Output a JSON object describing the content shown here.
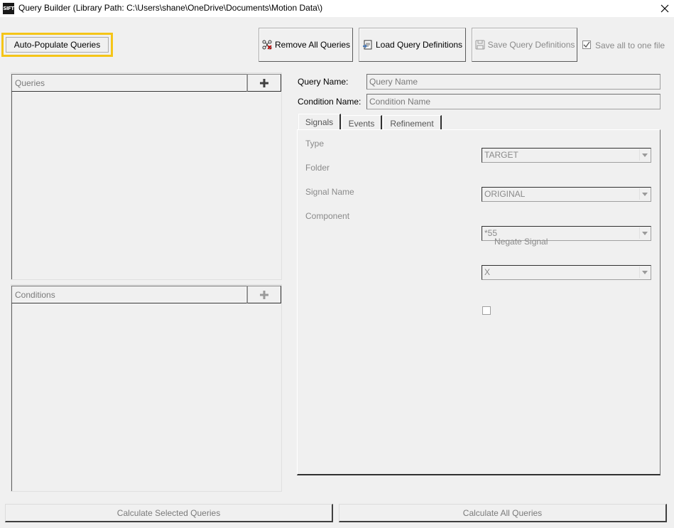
{
  "window": {
    "title": "Query Builder (Library Path: C:\\Users\\shane\\OneDrive\\Documents\\Motion Data\\)",
    "app_icon_text": "SIFT"
  },
  "toolbar": {
    "auto_populate": "Auto-Populate Queries",
    "remove_all": "Remove All Queries",
    "load_defs": "Load Query Definitions",
    "save_defs": "Save Query Definitions",
    "save_all_one_file": "Save all to one file"
  },
  "queries_panel": {
    "header": "Queries"
  },
  "conditions_panel": {
    "header": "Conditions"
  },
  "form": {
    "query_name_label": "Query Name:",
    "query_name_placeholder": "Query Name",
    "condition_name_label": "Condition Name:",
    "condition_name_placeholder": "Condition Name"
  },
  "tabs": [
    {
      "label": "Signals"
    },
    {
      "label": "Events"
    },
    {
      "label": "Refinement"
    }
  ],
  "signals": {
    "type_label": "Type",
    "type_value": "TARGET",
    "folder_label": "Folder",
    "folder_value": "ORIGINAL",
    "signal_name_label": "Signal Name",
    "signal_name_value": "*55",
    "component_label": "Component",
    "component_value": "X",
    "negate_label": "Negate Signal"
  },
  "bottom": {
    "calc_selected": "Calculate Selected Queries",
    "calc_all": "Calculate All Queries"
  },
  "colors": {
    "highlight": "#f5c518"
  }
}
